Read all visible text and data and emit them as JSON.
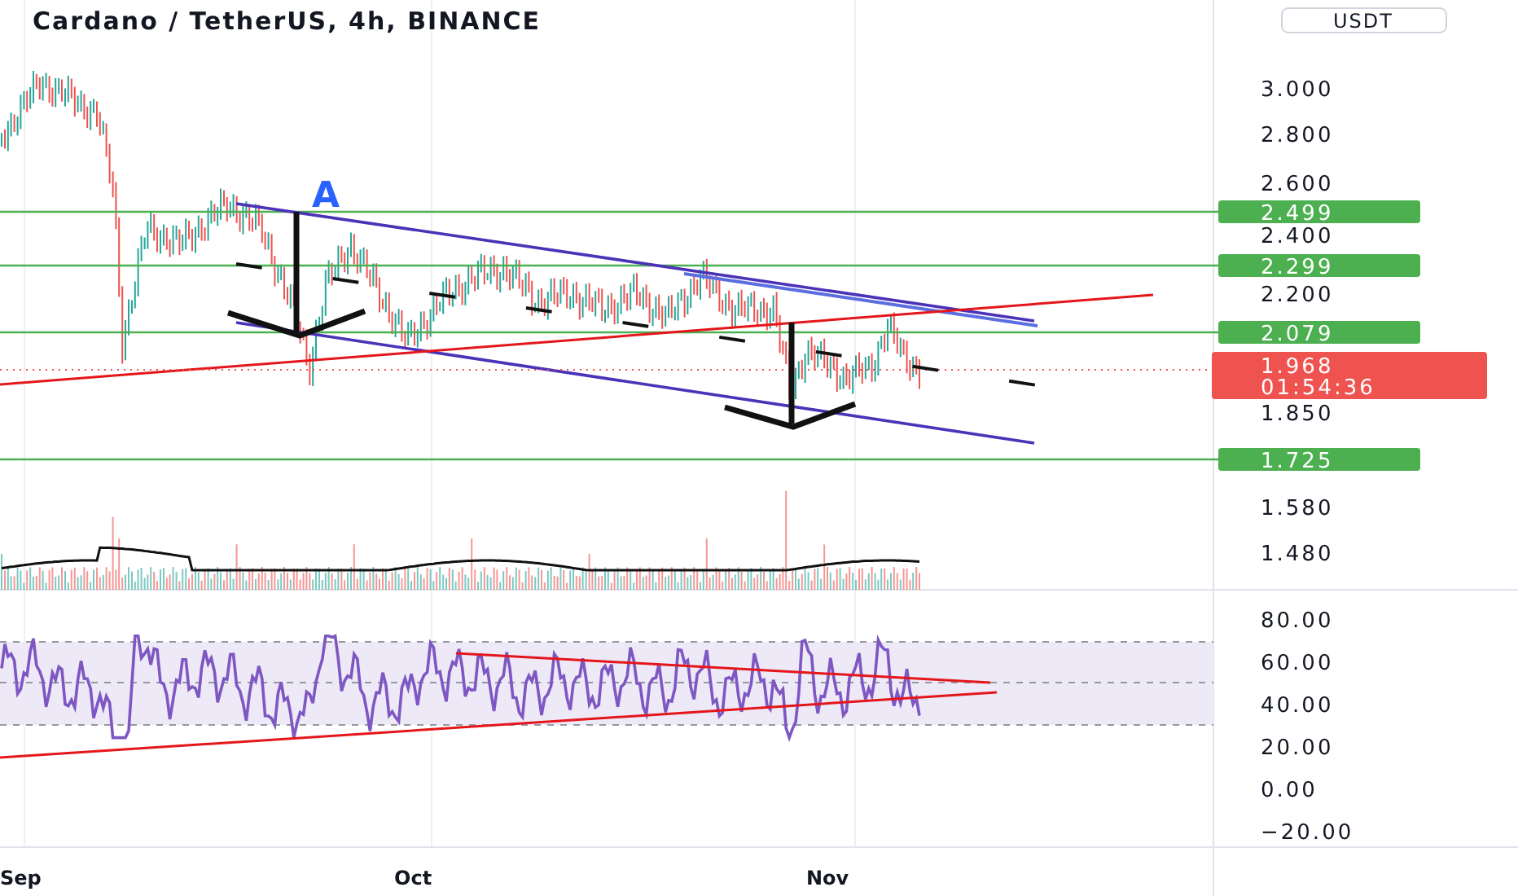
{
  "title": "Cardano / TetherUS, 4h, BINANCE",
  "currency_button": "USDT",
  "annotation": "A",
  "price_axis": [
    "3.000",
    "2.800",
    "2.600",
    "2.400",
    "2.200",
    "1.850",
    "1.580",
    "1.480"
  ],
  "levels": [
    {
      "price": "2.499"
    },
    {
      "price": "2.299"
    },
    {
      "price": "2.079"
    },
    {
      "price": "1.725"
    }
  ],
  "current_price": {
    "price": "1.968",
    "countdown": "01:54:36"
  },
  "rsi_axis": [
    "80.00",
    "60.00",
    "40.00",
    "20.00",
    "0.00",
    "−20.00"
  ],
  "time_axis": [
    "Sep",
    "Oct",
    "Nov"
  ]
}
